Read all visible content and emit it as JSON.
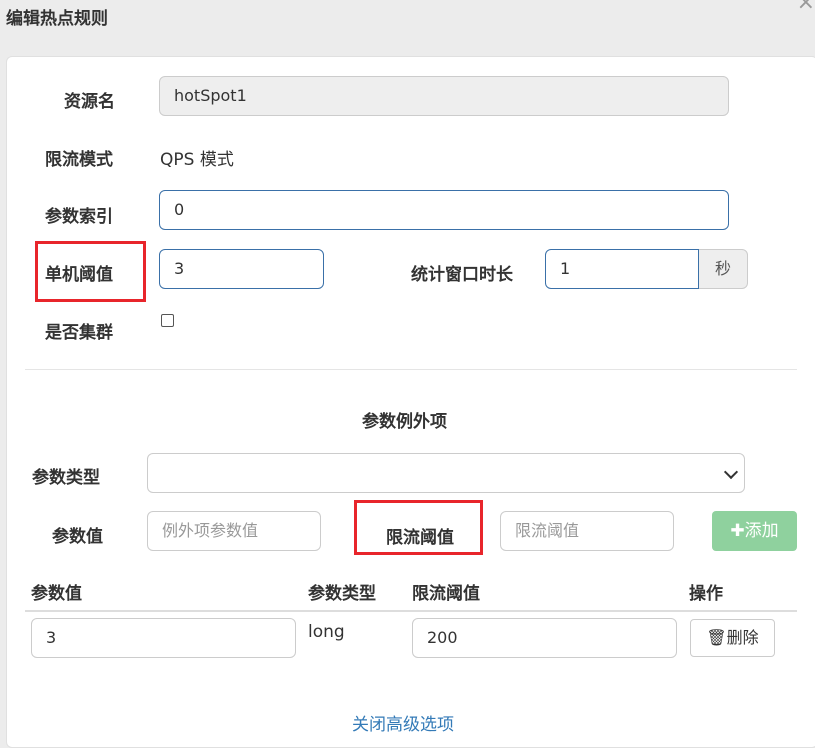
{
  "dialog": {
    "title": "编辑热点规则"
  },
  "form": {
    "resource_label": "资源名",
    "resource_value": "hotSpot1",
    "mode_label": "限流模式",
    "mode_value": "QPS 模式",
    "param_index_label": "参数索引",
    "param_index_value": "0",
    "threshold_label": "单机阈值",
    "threshold_value": "3",
    "window_label": "统计窗口时长",
    "window_value": "1",
    "window_unit": "秒",
    "cluster_label": "是否集群",
    "cluster_checked": false
  },
  "exceptions": {
    "section_title": "参数例外项",
    "param_type_label": "参数类型",
    "param_type_value": "",
    "param_value_label": "参数值",
    "param_value_placeholder": "例外项参数值",
    "limit_label": "限流阈值",
    "limit_placeholder": "限流阈值",
    "add_icon": "plus-icon",
    "add_label": "添加"
  },
  "table": {
    "headers": [
      "参数值",
      "参数类型",
      "限流阈值",
      "操作"
    ],
    "rows": [
      {
        "value": "3",
        "type": "long",
        "limit": "200",
        "delete_icon": "trash-icon",
        "delete_label": "删除"
      }
    ]
  },
  "footer": {
    "close_advanced": "关闭高级选项"
  },
  "colors": {
    "highlight": "#e8252b",
    "add_button": "#8fd19e",
    "link": "#337ab7",
    "input_border": "#3a70a8"
  }
}
